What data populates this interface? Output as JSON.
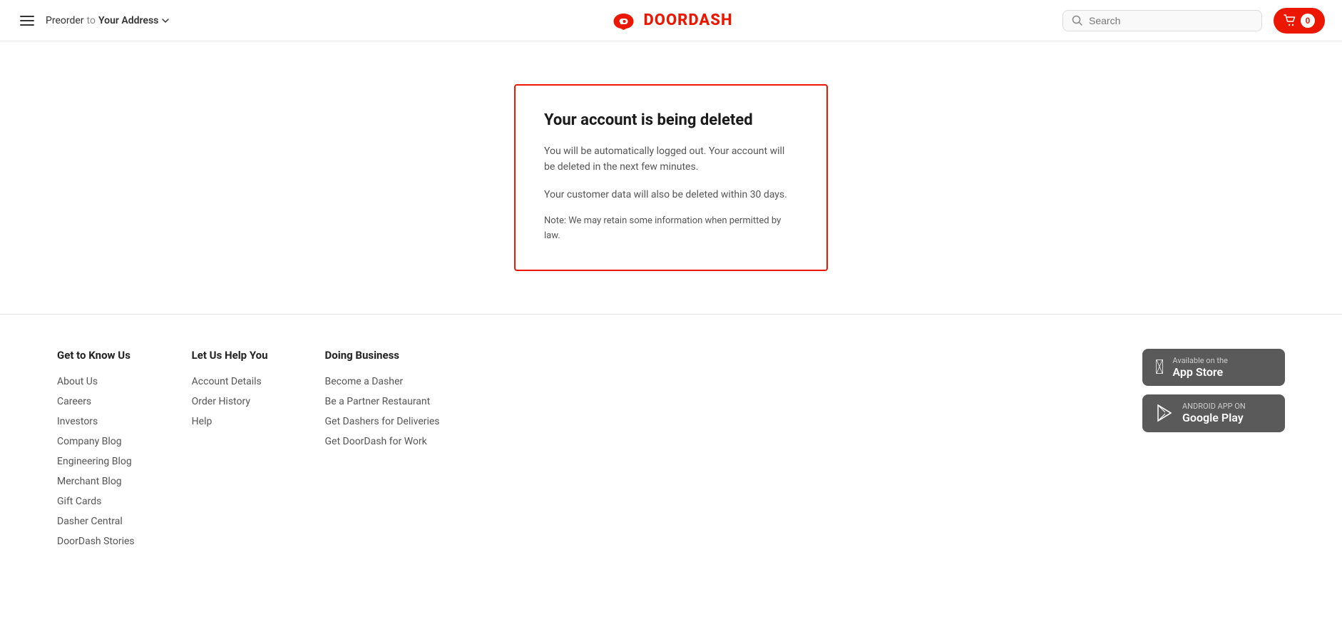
{
  "header": {
    "preorder_label": "Preorder",
    "to_label": "to",
    "address_label": "Your Address",
    "logo_text": "DOORDASH",
    "search_placeholder": "Search",
    "cart_count": "0"
  },
  "main": {
    "card": {
      "title": "Your account is being deleted",
      "para1": "You will be automatically logged out. Your account will be deleted in the next few minutes.",
      "para2": "Your customer data will also be deleted within 30 days.",
      "para3": "Note: We may retain some information when permitted by law."
    }
  },
  "footer": {
    "col1": {
      "heading": "Get to Know Us",
      "links": [
        "About Us",
        "Careers",
        "Investors",
        "Company Blog",
        "Engineering Blog",
        "Merchant Blog",
        "Gift Cards",
        "Dasher Central",
        "DoorDash Stories"
      ]
    },
    "col2": {
      "heading": "Let Us Help You",
      "links": [
        "Account Details",
        "Order History",
        "Help"
      ]
    },
    "col3": {
      "heading": "Doing Business",
      "links": [
        "Become a Dasher",
        "Be a Partner Restaurant",
        "Get Dashers for Deliveries",
        "Get DoorDash for Work"
      ]
    },
    "appstore": {
      "ios_top": "Available on the",
      "ios_bottom": "App Store",
      "android_top": "ANDROID APP ON",
      "android_bottom": "Google Play"
    }
  }
}
